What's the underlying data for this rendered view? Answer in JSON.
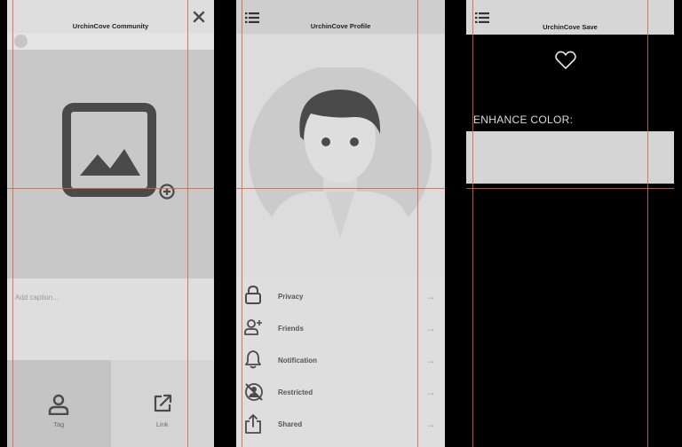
{
  "screens": {
    "community": {
      "title": "UrchinCove Community",
      "caption_placeholder": "Add caption...",
      "actions": {
        "tag": "Tag",
        "link": "Link"
      }
    },
    "profile": {
      "title": "UrchinCove Profile",
      "menu": [
        {
          "label": "Privacy",
          "icon": "lock-icon"
        },
        {
          "label": "Friends",
          "icon": "add-friend-icon"
        },
        {
          "label": "Notification",
          "icon": "bell-icon"
        },
        {
          "label": "Restricted",
          "icon": "restricted-icon"
        },
        {
          "label": "Shared",
          "icon": "share-icon"
        }
      ],
      "arrow": "→"
    },
    "save": {
      "title": "UrchinCove Save",
      "enhance_label": "ENHANCE COLOR:"
    }
  },
  "colors": {
    "guide_line": "#d4683e",
    "background": "#000000",
    "icon_dark": "#4a4a4a"
  }
}
